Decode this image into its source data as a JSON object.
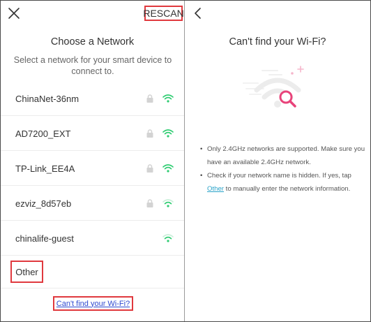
{
  "left_panel": {
    "rescan_label": "RESCAN",
    "title": "Choose a Network",
    "subtitle": "Select a network for your smart device to connect to.",
    "networks": [
      {
        "name": "ChinaNet-36nm",
        "locked": true
      },
      {
        "name": "AD7200_EXT",
        "locked": true
      },
      {
        "name": "TP-Link_EE4A",
        "locked": true
      },
      {
        "name": "ezviz_8d57eb",
        "locked": true
      },
      {
        "name": "chinalife-guest",
        "locked": false
      }
    ],
    "other_label": "Other",
    "cant_find_link": "Can't find your Wi-Fi?"
  },
  "right_panel": {
    "title": "Can't find your Wi-Fi?",
    "bullet1": "Only 2.4GHz networks are supported. Make sure you have an available 2.4GHz network.",
    "bullet2_before": "Check if your network name is hidden. If yes, tap ",
    "bullet2_link": "Other",
    "bullet2_after": " to manually enter the network information."
  },
  "colors": {
    "accent_green": "#2ecc71",
    "highlight_red": "#e0393e",
    "link_blue": "#2f4ad0",
    "other_link": "#2aa3c9",
    "magnifier_pink": "#e8437a"
  },
  "icons": {
    "close": "close-icon",
    "back": "chevron-left-icon",
    "lock": "lock-icon",
    "wifi": "wifi-icon",
    "search": "search-icon"
  }
}
